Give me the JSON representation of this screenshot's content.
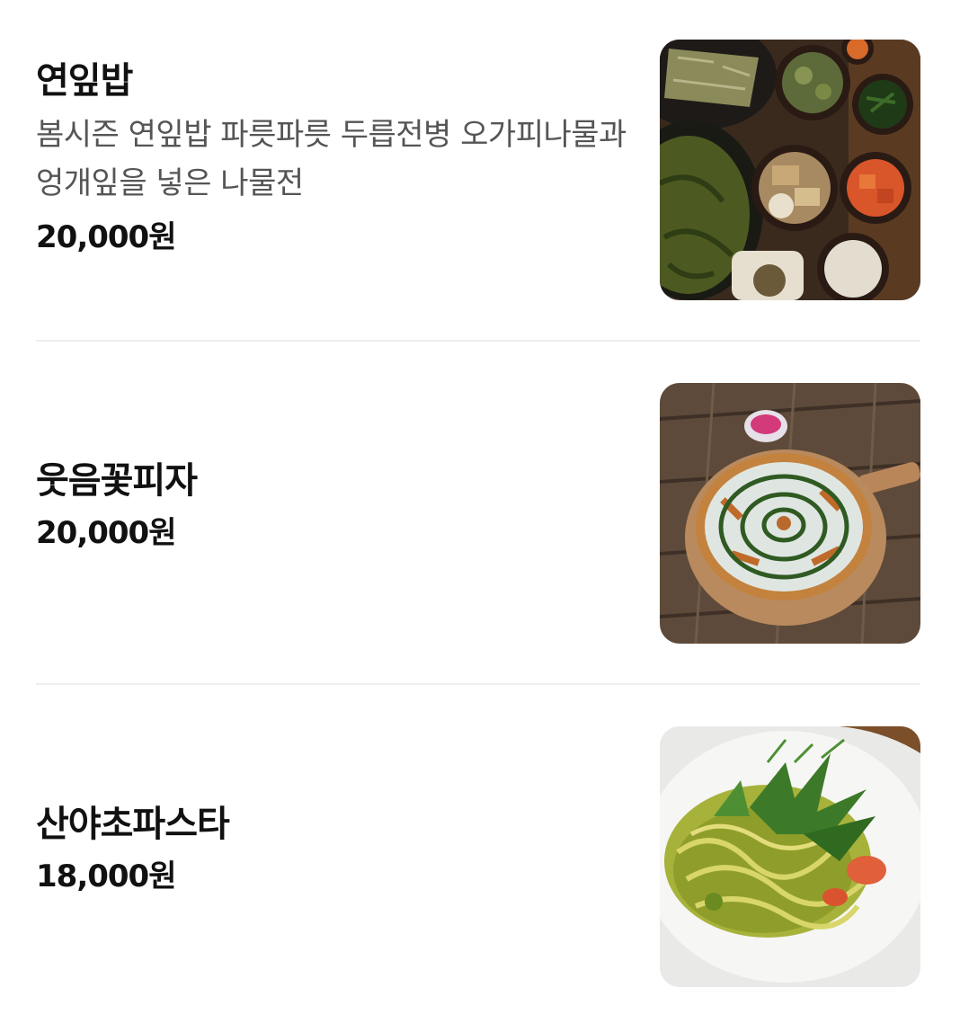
{
  "menu": {
    "items": [
      {
        "name": "연잎밥",
        "description": "봄시즌 연잎밥 파릇파릇 두릅전병 오가피나물과 엉개잎을 넣은 나물전",
        "price": "20,000원",
        "image": "lotus-leaf-rice-set-photo"
      },
      {
        "name": "웃음꽃피자",
        "description": "",
        "price": "20,000원",
        "image": "pizza-photo"
      },
      {
        "name": "산야초파스타",
        "description": "",
        "price": "18,000원",
        "image": "wild-herb-pasta-photo"
      }
    ]
  },
  "colors": {
    "text_primary": "#111111",
    "text_secondary": "#555555",
    "divider": "#eeeeee"
  }
}
